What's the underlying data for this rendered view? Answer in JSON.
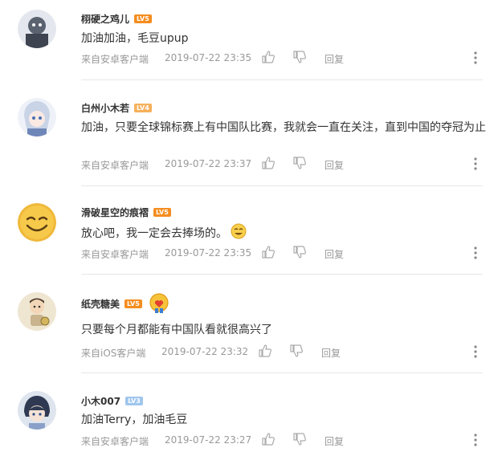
{
  "comments": [
    {
      "username": "栩硬之鸡儿",
      "level": "LV5",
      "text": "加油加油，毛豆upup",
      "source": "来自安卓客户端",
      "time": "2019-07-22 23:35",
      "reply_label": "回复"
    },
    {
      "username": "白州小木若",
      "level": "LV4",
      "text": "加油，只要全球锦标赛上有中国队比赛，我就会一直在关注，直到中国的夺冠为止",
      "source": "来自安卓客户端",
      "time": "2019-07-22 23:37",
      "reply_label": "回复"
    },
    {
      "username": "滑破星空的痕褶",
      "level": "LV5",
      "text": "放心吧，我一定会去捧场的。",
      "source": "来自安卓客户端",
      "time": "2019-07-22 23:35",
      "reply_label": "回复"
    },
    {
      "username": "纸壳糖美",
      "level": "LV5",
      "text": "只要每个月都能有中国队看就很高兴了",
      "source": "来自iOS客户端",
      "time": "2019-07-22 23:32",
      "reply_label": "回复"
    },
    {
      "username": "小木007",
      "level": "LV3",
      "text": "加油Terry，加油毛豆",
      "source": "来自安卓客户端",
      "time": "2019-07-22 23:27",
      "reply_label": "回复"
    }
  ],
  "colors": {
    "badge_orange": "#f58d1f",
    "badge_blue": "#9fc6ee",
    "meta_gray": "#999999",
    "divider": "#e7e7e7"
  },
  "icons": {
    "like": "thumbs-up-icon",
    "dislike": "thumbs-down-icon",
    "more": "more-vertical-icon"
  }
}
